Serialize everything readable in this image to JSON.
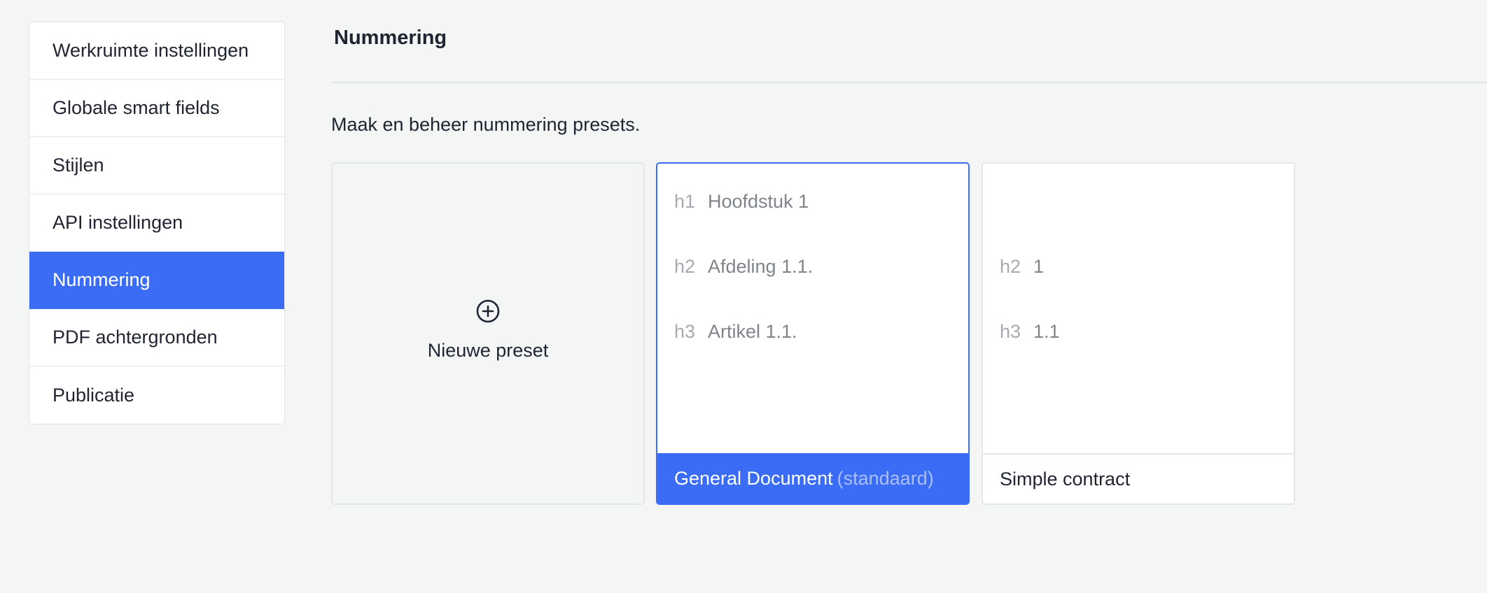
{
  "sidebar": {
    "items": [
      {
        "label": "Werkruimte instellingen"
      },
      {
        "label": "Globale smart fields"
      },
      {
        "label": "Stijlen"
      },
      {
        "label": "API instellingen"
      },
      {
        "label": "Nummering",
        "active": true
      },
      {
        "label": "PDF achtergronden"
      },
      {
        "label": "Publicatie"
      }
    ]
  },
  "header": {
    "title": "Nummering"
  },
  "main": {
    "description": "Maak en beheer nummering presets.",
    "new_preset_label": "Nieuwe preset",
    "new_preset_icon": "plus-circle-icon",
    "presets": [
      {
        "name": "General Document",
        "default_tag": "(standaard)",
        "selected": true,
        "levels": [
          {
            "tag": "h1",
            "text": "Hoofdstuk 1"
          },
          {
            "tag": "h2",
            "text": "Afdeling 1.1."
          },
          {
            "tag": "h3",
            "text": "Artikel 1.1."
          }
        ]
      },
      {
        "name": "Simple contract",
        "selected": false,
        "levels": [
          {
            "tag": "h2",
            "text": "1"
          },
          {
            "tag": "h3",
            "text": "1.1"
          }
        ]
      }
    ]
  },
  "colors": {
    "accent": "#3a6cf5",
    "background": "#f4f5f5",
    "text": "#1f2430",
    "muted_tag": "#a7abb1",
    "muted_text": "#7f848b"
  }
}
